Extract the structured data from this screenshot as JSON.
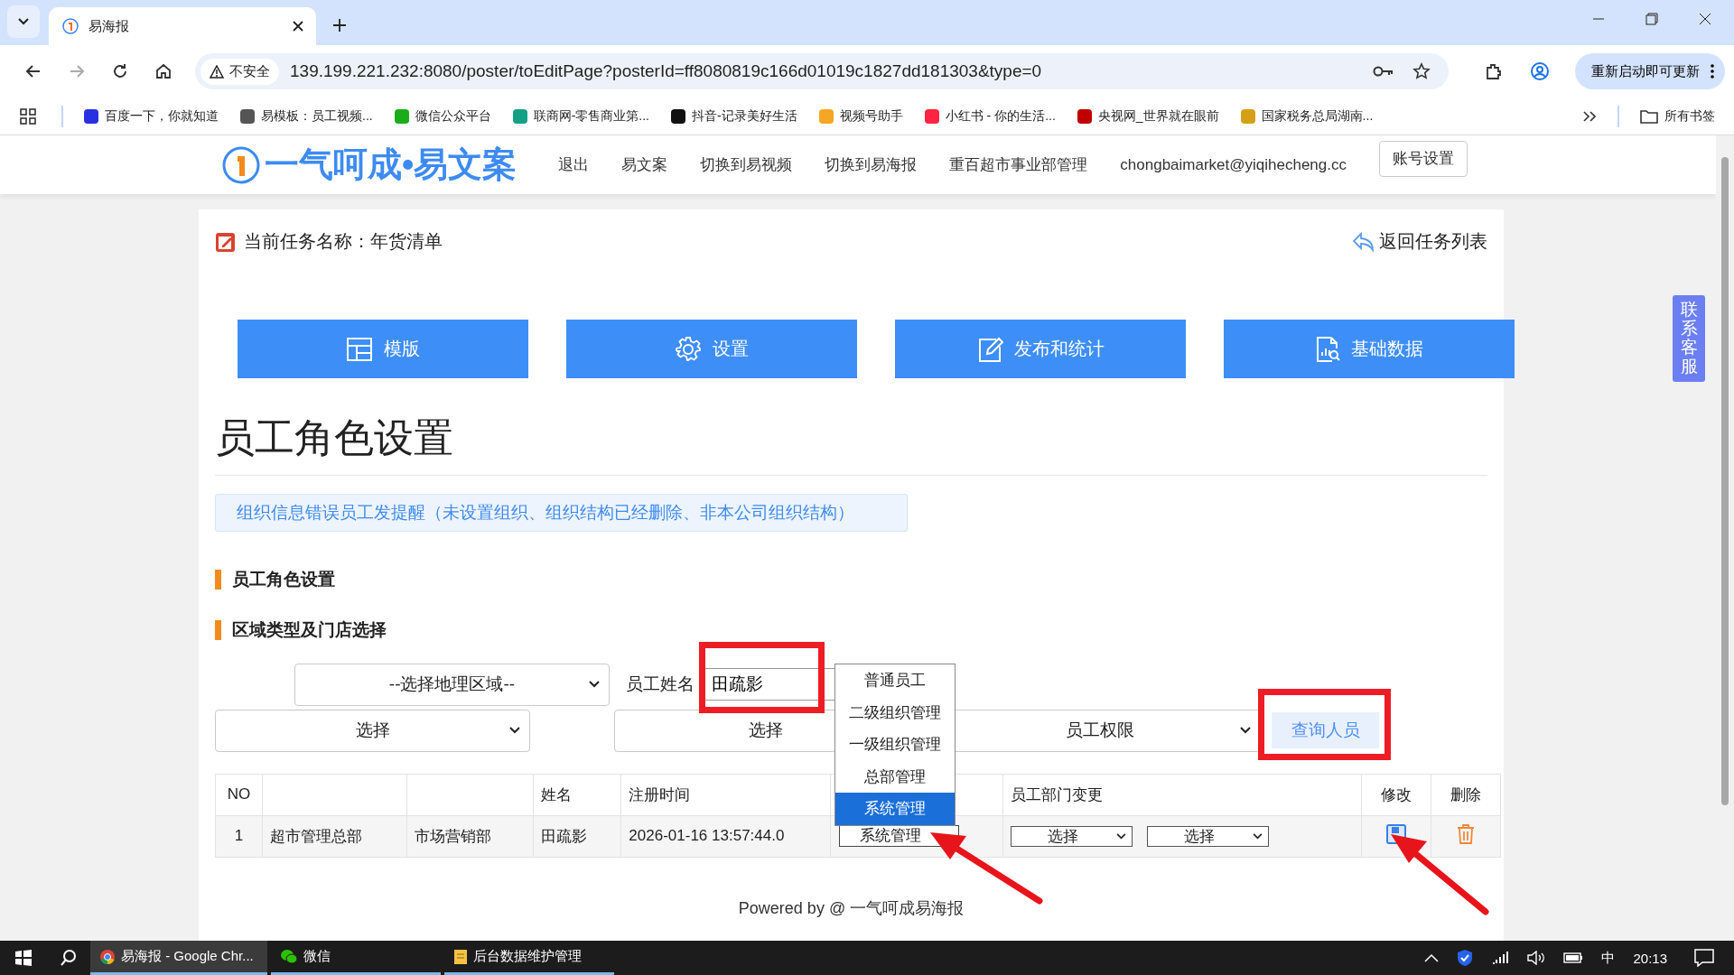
{
  "browser": {
    "tabs": [
      {
        "title": "易海报",
        "selected": true
      }
    ],
    "address": {
      "security": "不安全",
      "url": "139.199.221.232:8080/poster/toEditPage?posterId=ff8080819c166d01019c1827dd181303&type=0"
    },
    "update_button": "重新启动即可更新",
    "bookmarks": [
      {
        "label": "百度一下，你就知道",
        "color": "#2932e1"
      },
      {
        "label": "易模板：员工视频...",
        "color": "#555555"
      },
      {
        "label": "微信公众平台",
        "color": "#1aad19"
      },
      {
        "label": "联商网-零售商业第...",
        "color": "#14a085"
      },
      {
        "label": "抖音-记录美好生活",
        "color": "#111111"
      },
      {
        "label": "视频号助手",
        "color": "#f5a623"
      },
      {
        "label": "小红书 - 你的生活...",
        "color": "#ff2442"
      },
      {
        "label": "央视网_世界就在眼前",
        "color": "#c00000"
      },
      {
        "label": "国家税务总局湖南...",
        "color": "#d4a017"
      }
    ],
    "all_bookmarks": "所有书签"
  },
  "header": {
    "logo": "一气呵成•易文案",
    "nav": [
      "退出",
      "易文案",
      "切换到易视频",
      "切换到易海报",
      "重百超市事业部管理",
      "chongbaimarket@yiqihecheng.cc"
    ],
    "account_button": "账号设置"
  },
  "task": {
    "title": "当前任务名称：年货清单",
    "back_link": "返回任务列表"
  },
  "modules": [
    {
      "label": "模版",
      "kind": "layout"
    },
    {
      "label": "设置",
      "kind": "gear"
    },
    {
      "label": "发布和统计",
      "kind": "edit"
    },
    {
      "label": "基础数据",
      "kind": "report"
    }
  ],
  "page_title": "员工角色设置",
  "alert": "组织信息错误员工发提醒（未设置组织、组织结构已经删除、非本公司组织结构）",
  "sections": [
    "员工角色设置",
    "区域类型及门店选择"
  ],
  "filters": {
    "region": "--选择地理区域--",
    "name_label": "员工姓名",
    "name_value": "田疏影",
    "select_1": "选择",
    "select_2": "选择",
    "permission": "员工权限",
    "query_button": "查询人员"
  },
  "role_dropdown": {
    "options": [
      {
        "label": "普通员工",
        "selected": false
      },
      {
        "label": "二级组织管理",
        "selected": false
      },
      {
        "label": "一级组织管理",
        "selected": false
      },
      {
        "label": "总部管理",
        "selected": false
      },
      {
        "label": "系统管理",
        "selected": true
      }
    ]
  },
  "table": {
    "columns": [
      "NO",
      null,
      null,
      "姓名",
      "注册时间",
      null,
      "员工部门变更",
      "修改",
      "删除"
    ],
    "rows": [
      {
        "no": "1",
        "org": "超市管理总部",
        "dept": "市场营销部",
        "name": "田疏影",
        "registered": "2026-01-16 13:57:44.0",
        "role": "系统管理",
        "dept_change": [
          "选择",
          "选择"
        ]
      }
    ]
  },
  "footer": "Powered by @ 一气呵成易海报",
  "support": "联系客服",
  "taskbar": {
    "apps": [
      {
        "label": "易海报 - Google Chr...",
        "selected": true
      },
      {
        "label": "微信",
        "selected": false
      },
      {
        "label": "后台数据维护管理",
        "selected": false
      }
    ],
    "ime": "中",
    "time": "20:13"
  }
}
